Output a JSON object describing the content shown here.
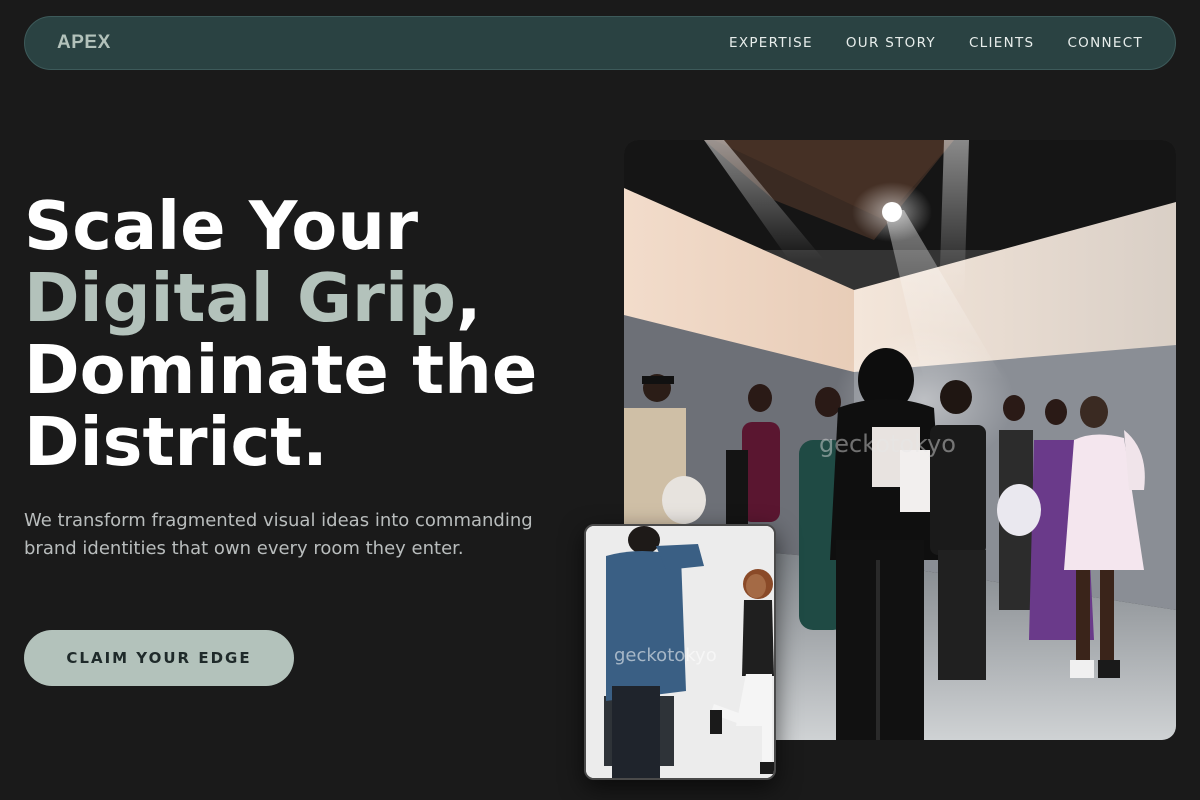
{
  "nav": {
    "logo": "APEX",
    "links": [
      "EXPERTISE",
      "OUR STORY",
      "CLIENTS",
      "CONNECT"
    ]
  },
  "hero": {
    "headline_line1": "Scale Your",
    "headline_accent": "Digital Grip",
    "headline_comma": ",",
    "headline_line3": "Dominate the",
    "headline_line4": "District.",
    "subtext": "We transform fragmented visual ideas into commanding brand identities that own every room they enter.",
    "cta_label": "CLAIM YOUR EDGE"
  },
  "images": {
    "main_watermark": "geckotokyo",
    "inset_watermark": "geckotokyo"
  },
  "colors": {
    "background": "#1a1a1a",
    "nav_bg": "#2a4242",
    "accent": "#b3c2bb",
    "text": "#ffffff",
    "muted": "#b9bdbd"
  }
}
